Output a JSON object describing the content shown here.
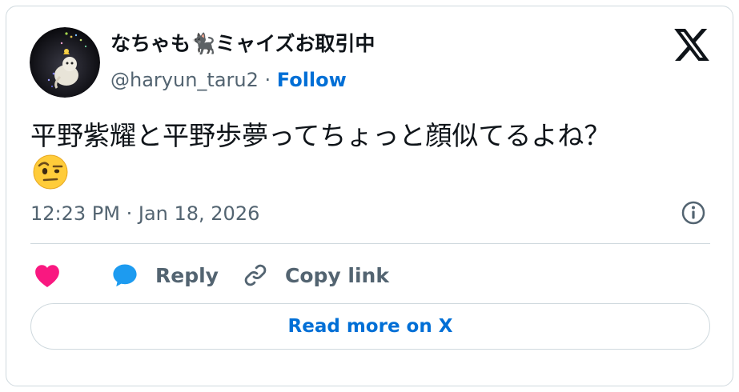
{
  "author": {
    "display_name": "なちゃも🐈‍⬛ミャイズお取引中",
    "handle": "@haryun_taru2",
    "separator": "·",
    "follow_label": "Follow"
  },
  "tweet": {
    "text": "平野紫耀と平野歩夢ってちょっと顔似てるよね？",
    "emoji": "face-with-raised-eyebrow",
    "timestamp": "12:23 PM · Jan 18, 2026"
  },
  "actions": {
    "like_icon": "heart-icon",
    "reply_label": "Reply",
    "copy_label": "Copy link"
  },
  "footer": {
    "read_more_label": "Read more on X"
  },
  "colors": {
    "link": "#006fd6",
    "secondary_text": "#536471",
    "heart": "#f91880",
    "reply_bubble": "#1d9bf0",
    "border": "#cfd9de"
  }
}
